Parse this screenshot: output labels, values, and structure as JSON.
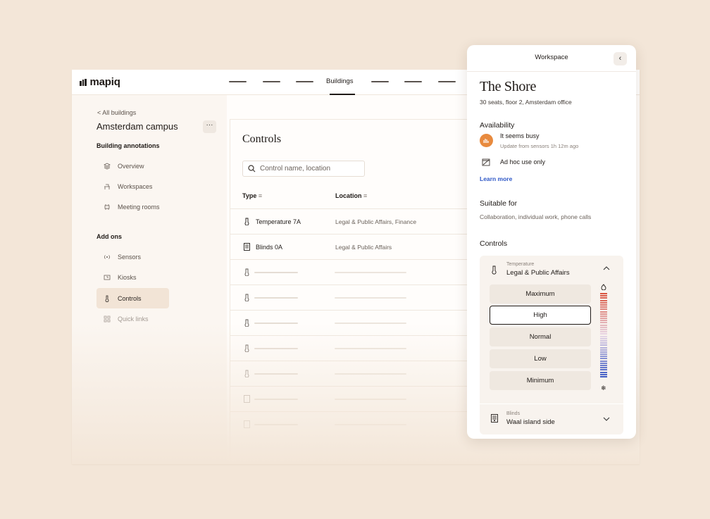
{
  "app": {
    "logo": "mapiq",
    "nav_active": "Buildings"
  },
  "sidebar": {
    "back_link": "< All buildings",
    "campus": "Amsterdam campus",
    "more": "···",
    "section_annotations": "Building annotations",
    "annotation_items": [
      {
        "label": "Overview",
        "icon": "layers-icon"
      },
      {
        "label": "Workspaces",
        "icon": "desk-icon"
      },
      {
        "label": "Meeting rooms",
        "icon": "meeting-room-icon"
      }
    ],
    "section_addons": "Add ons",
    "addon_items": [
      {
        "label": "Sensors",
        "icon": "sensor-icon"
      },
      {
        "label": "Kiosks",
        "icon": "kiosk-icon"
      },
      {
        "label": "Controls",
        "icon": "thermometer-icon",
        "active": true
      },
      {
        "label": "Quick links",
        "icon": "grid-icon"
      }
    ]
  },
  "main": {
    "title": "Controls",
    "search_placeholder": "Control name, location",
    "col_type": "Type",
    "col_location": "Location",
    "rows": [
      {
        "type": "Temperature 7A",
        "location": "Legal & Public Affairs, Finance",
        "icon": "thermometer-icon"
      },
      {
        "type": "Blinds 0A",
        "location": "Legal & Public Affairs",
        "icon": "blinds-icon"
      }
    ]
  },
  "panel": {
    "title": "Workspace",
    "back": "‹",
    "name": "The Shore",
    "meta": "30 seats, floor 2, Amsterdam office",
    "availability_heading": "Availability",
    "busy_title": "It seems busy",
    "busy_sub": "Update from sensors 1h 12m ago",
    "adhoc": "Ad hoc use only",
    "learn_more": "Learn more",
    "suitable_heading": "Suitable for",
    "suitable_text": "Collaboration, individual work, phone calls",
    "controls_heading": "Controls",
    "temperature": {
      "sub": "Temperature",
      "main": "Legal & Public Affairs",
      "levels": [
        "Maximum",
        "High",
        "Normal",
        "Low",
        "Minimum"
      ],
      "selected": "High"
    },
    "blinds": {
      "sub": "Blinds",
      "main": "Waal island side"
    },
    "colors": {
      "busy": "#e88a3e",
      "link": "#2f58c7",
      "hot": "#d9543f",
      "cold": "#3d5ac4"
    }
  }
}
